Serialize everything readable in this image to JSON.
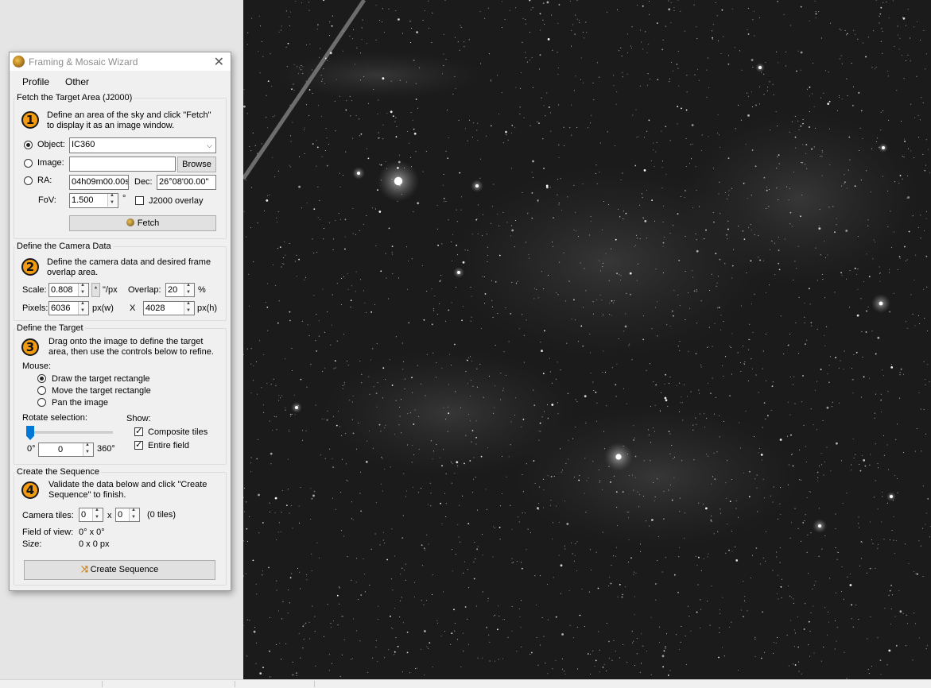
{
  "window": {
    "title": "Framing & Mosaic Wizard",
    "close_glyph": "✕",
    "icon": "app-icon"
  },
  "menu": [
    "Profile",
    "Other"
  ],
  "section1": {
    "legend": "Fetch the Target Area (J2000)",
    "number": "1",
    "desc_line1": "Define an area of the sky and click \"Fetch\"",
    "desc_line2": "to display it as an image window.",
    "object_label": "Object:",
    "object_value": "IC360",
    "image_label": "Image:",
    "image_value": "",
    "browse_label": "Browse",
    "ra_label": "RA:",
    "ra_value": "04h09m00.00s",
    "dec_label": "Dec:",
    "dec_value": "26°08'00.00\"",
    "fov_label": "FoV:",
    "fov_value": "1.500",
    "fov_unit": "°",
    "overlay_label": "J2000 overlay",
    "overlay_checked": false,
    "fetch_label": "Fetch",
    "selected_source": "object"
  },
  "section2": {
    "legend": "Define the Camera Data",
    "number": "2",
    "desc_line1": "Define the camera data and desired frame",
    "desc_line2": "overlap area.",
    "scale_label": "Scale:",
    "scale_value": "0.808",
    "scale_unit": "\"/px",
    "overlap_label": "Overlap:",
    "overlap_value": "20",
    "overlap_unit": "%",
    "pixels_label": "Pixels:",
    "pixels_w": "6036",
    "pixels_w_unit": "px(w)",
    "pixels_x": "X",
    "pixels_h": "4028",
    "pixels_h_unit": "px(h)"
  },
  "section3": {
    "legend": "Define the Target",
    "number": "3",
    "desc_line1": "Drag onto the image to define the target",
    "desc_line2": "area, then use the controls below to refine.",
    "mouse_label": "Mouse:",
    "mouse_options": [
      "Draw the target rectangle",
      "Move the target rectangle",
      "Pan the image"
    ],
    "mouse_selected": 0,
    "rotate_label": "Rotate selection:",
    "rotate_min": "0°",
    "rotate_value": "0",
    "rotate_max": "360°",
    "rotate_fraction": 0,
    "show_label": "Show:",
    "composite_label": "Composite tiles",
    "composite_checked": true,
    "entire_label": "Entire field",
    "entire_checked": true
  },
  "section4": {
    "legend": "Create the Sequence",
    "number": "4",
    "desc_line1": "Validate the data below and click \"Create",
    "desc_line2": "Sequence\" to finish.",
    "tiles_label": "Camera tiles:",
    "tiles_a": "0",
    "tiles_x": "x",
    "tiles_b": "0",
    "tiles_count": "(0 tiles)",
    "fov_label": "Field of view:",
    "fov_value": "0° x 0°",
    "size_label": "Size:",
    "size_value": "0 x 0 px",
    "create_label": "Create Sequence"
  },
  "colors": {
    "step_badge": "#f39c12",
    "accent": "#0078d7",
    "sky": "#1b1b1b"
  }
}
